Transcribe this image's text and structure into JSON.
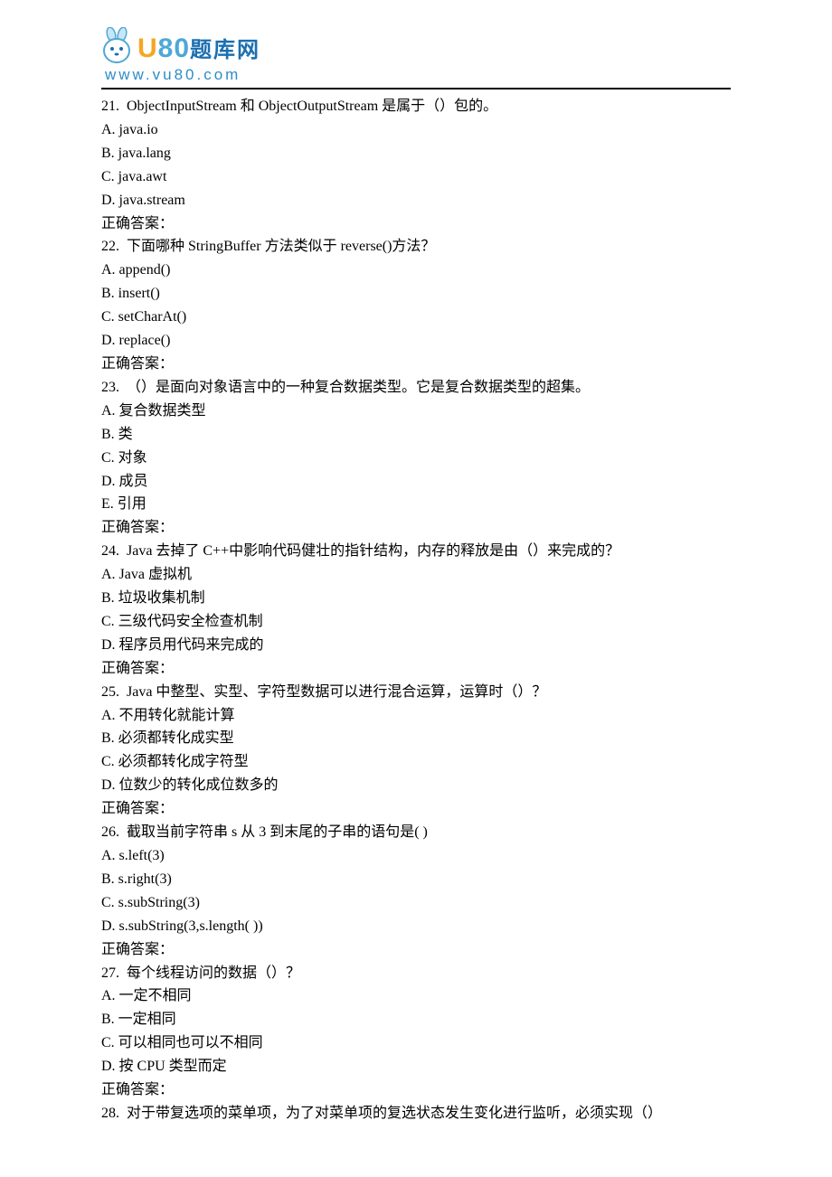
{
  "logo": {
    "url": "www.vu80.com",
    "chinese_suffix": "题库网",
    "brand_letters": "80"
  },
  "answer_label": "正确答案：",
  "questions": [
    {
      "num": "21.",
      "text": "ObjectInputStream 和 ObjectOutputStream 是属于（）包的。",
      "options": [
        "A. java.io",
        "B. java.lang",
        "C. java.awt",
        "D. java.stream"
      ]
    },
    {
      "num": "22.",
      "text": "下面哪种 StringBuffer 方法类似于 reverse()方法？",
      "options": [
        "A. append()",
        "B. insert()",
        "C. setCharAt()",
        "D. replace()"
      ]
    },
    {
      "num": "23.",
      "text": "（）是面向对象语言中的一种复合数据类型。它是复合数据类型的超集。",
      "options": [
        "A.  复合数据类型",
        "B.  类",
        "C.  对象",
        "D.  成员",
        "E.  引用"
      ]
    },
    {
      "num": "24.",
      "text": "Java 去掉了 C++中影响代码健壮的指针结构，内存的释放是由（）来完成的？",
      "options": [
        "A. Java 虚拟机",
        "B.  垃圾收集机制",
        "C. 三级代码安全检查机制",
        "D.  程序员用代码来完成的"
      ]
    },
    {
      "num": "25.",
      "text": "Java 中整型、实型、字符型数据可以进行混合运算，运算时（）？",
      "options": [
        "A.  不用转化就能计算",
        "B.  必须都转化成实型",
        "C.  必须都转化成字符型",
        "D.  位数少的转化成位数多的"
      ]
    },
    {
      "num": "26.",
      "text": "截取当前字符串 s 从 3 到末尾的子串的语句是( )",
      "options": [
        "A. s.left(3)",
        "B. s.right(3)",
        "C. s.subString(3)",
        "D. s.subString(3,s.length( ))"
      ]
    },
    {
      "num": "27.",
      "text": "每个线程访问的数据（）？",
      "options": [
        "A.  一定不相同",
        "B.  一定相同",
        "C.  可以相同也可以不相同",
        "D.  按 CPU 类型而定"
      ]
    },
    {
      "num": "28.",
      "text": "对于带复选项的菜单项，为了对菜单项的复选状态发生变化进行监听，必须实现（）",
      "options": []
    }
  ]
}
